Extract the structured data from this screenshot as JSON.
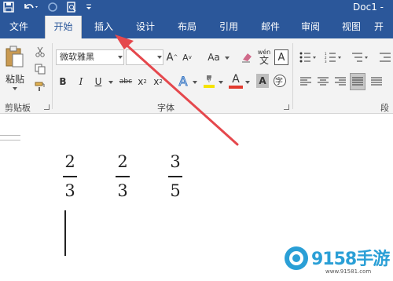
{
  "window": {
    "title": "Doc1 -"
  },
  "tabs": [
    {
      "label": "文件"
    },
    {
      "label": "开始"
    },
    {
      "label": "插入"
    },
    {
      "label": "设计"
    },
    {
      "label": "布局"
    },
    {
      "label": "引用"
    },
    {
      "label": "邮件"
    },
    {
      "label": "审阅"
    },
    {
      "label": "视图"
    },
    {
      "label": "开"
    }
  ],
  "clipboard": {
    "paste_label": "粘贴",
    "group_label": "剪贴板"
  },
  "font": {
    "name": "微软雅黑",
    "size": "",
    "group_label": "字体",
    "aa_label": "Aa",
    "pinyin_label": "wén",
    "enclose_label": "字"
  },
  "paragraph": {
    "group_label": "段"
  },
  "document": {
    "fractions": [
      {
        "numerator": "2",
        "denominator": "3"
      },
      {
        "numerator": "2",
        "denominator": "3"
      },
      {
        "numerator": "3",
        "denominator": "5"
      }
    ]
  },
  "watermark": {
    "text": "9158手游",
    "url": "www.91581.com"
  },
  "colors": {
    "ribbon_blue": "#2b579a",
    "arrow": "#e5484d",
    "watermark": "#2a9fd6"
  }
}
